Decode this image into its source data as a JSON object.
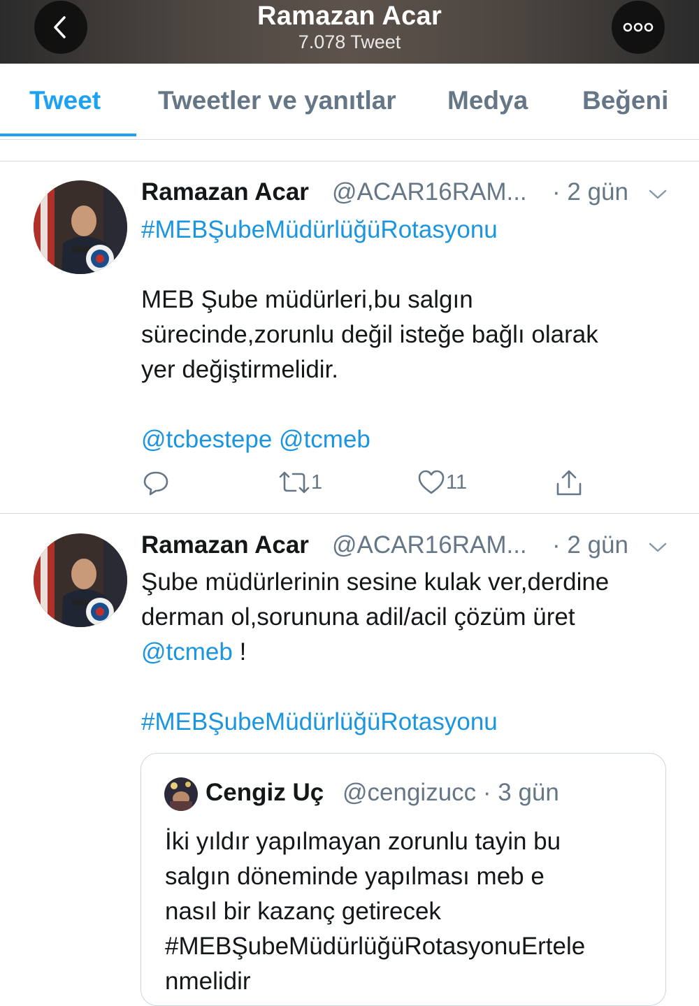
{
  "header": {
    "title": "Ramazan Acar",
    "subtitle": "7.078 Tweet",
    "back_icon": "chevron-left-icon",
    "more_icon": "more-options-icon"
  },
  "tabs": [
    {
      "label": "Tweet",
      "active": true
    },
    {
      "label": "Tweetler ve yanıtlar",
      "active": false
    },
    {
      "label": "Medya",
      "active": false
    },
    {
      "label": "Beğeni",
      "active": false
    }
  ],
  "colors": {
    "accent": "#1da1f2",
    "link": "#1b95e0",
    "muted": "#657786"
  },
  "tweets": [
    {
      "name": "Ramazan Acar",
      "handle": "@ACAR16RAM...",
      "time": "· 2 gün",
      "hashtag": "#MEBŞubeMüdürlüğüRotasyonu",
      "lines": [
        "MEB Şube müdürleri,bu salgın",
        "sürecinde,zorunlu değil isteğe bağlı olarak",
        "yer değiştirmelidir."
      ],
      "mention1": "@tcbestepe",
      "mention2": "@tcmeb",
      "actions": {
        "reply": "",
        "retweet": "1",
        "like": "11",
        "share": ""
      }
    },
    {
      "name": "Ramazan Acar",
      "handle": "@ACAR16RAM...",
      "time": "· 2 gün",
      "lines": [
        "Şube müdürlerinin sesine kulak ver,derdine",
        "derman ol,sorununa adil/acil çözüm üret"
      ],
      "mention": "@tcmeb",
      "after_mention": " !",
      "hashtag": "#MEBŞubeMüdürlüğüRotasyonu",
      "quote": {
        "name": "Cengiz Uç",
        "handle": "@cengizucc · 3 gün",
        "lines": [
          "İki yıldır yapılmayan zorunlu tayin bu",
          "salgın döneminde yapılması meb e",
          "nasıl bir kazanç getirecek",
          "#MEBŞubeMüdürlüğüRotasyonuErtele",
          "nmelidir"
        ]
      }
    }
  ]
}
